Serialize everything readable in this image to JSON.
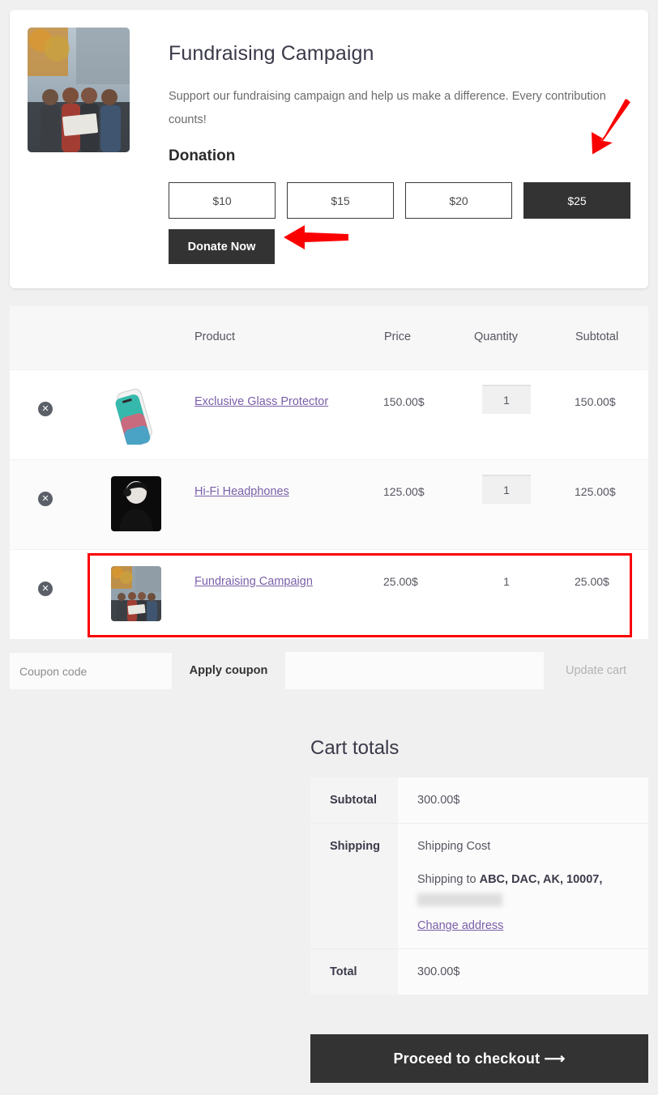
{
  "campaign": {
    "title": "Fundraising Campaign",
    "description": "Support our fundraising campaign and help us make a difference. Every contribution counts!",
    "donation_heading": "Donation",
    "amounts": [
      {
        "label": "$10",
        "selected": false
      },
      {
        "label": "$15",
        "selected": false
      },
      {
        "label": "$20",
        "selected": false
      },
      {
        "label": "$25",
        "selected": true
      }
    ],
    "donate_button": "Donate Now",
    "thumb_icon": "campaign-photo"
  },
  "annotations": {
    "arrow_color": "#fb0000",
    "highlight_color": "#fb0000",
    "arrow_to_amount": "arrow-pointing-to-25-button",
    "arrow_to_donate": "arrow-pointing-to-donate-now",
    "highlighted_row": "Fundraising Campaign"
  },
  "cart": {
    "columns": [
      "",
      "",
      "Product",
      "Price",
      "Quantity",
      "Subtotal"
    ],
    "headers": {
      "product": "Product",
      "price": "Price",
      "quantity": "Quantity",
      "subtotal": "Subtotal"
    },
    "remove_icon": "remove-circle-x-icon",
    "rows": [
      {
        "name": "Exclusive Glass Protector",
        "price": "150.00$",
        "quantity": "1",
        "subtotal": "150.00$",
        "qty_editable": true,
        "thumb": "glass-protector-photo"
      },
      {
        "name": "Hi-Fi Headphones",
        "price": "125.00$",
        "quantity": "1",
        "subtotal": "125.00$",
        "qty_editable": true,
        "thumb": "headphones-photo"
      },
      {
        "name": "Fundraising Campaign",
        "price": "25.00$",
        "quantity": "1",
        "subtotal": "25.00$",
        "qty_editable": false,
        "thumb": "campaign-photo"
      }
    ]
  },
  "coupon": {
    "placeholder": "Coupon code",
    "value": "",
    "apply_label": "Apply coupon",
    "update_cart_label": "Update cart"
  },
  "totals": {
    "title": "Cart totals",
    "subtotal_label": "Subtotal",
    "subtotal_value": "300.00$",
    "shipping_label": "Shipping",
    "shipping_cost": "Shipping Cost",
    "shipping_to_prefix": "Shipping to ",
    "shipping_to_address": "ABC, DAC, AK, 10007,",
    "shipping_to_hidden": "",
    "change_address_label": "Change address",
    "total_label": "Total",
    "total_value": "300.00$",
    "checkout_label": "Proceed to checkout  ⟶"
  }
}
